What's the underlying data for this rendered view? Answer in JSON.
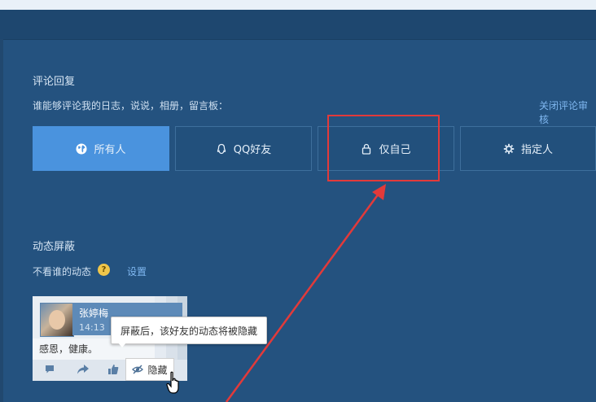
{
  "comment_reply": {
    "title": "评论回复",
    "question": "谁能够评论我的日志，说说，相册，留言板：",
    "close_review_link": "关闭评论审核",
    "options": [
      {
        "label": "所有人",
        "icon": "globe-icon",
        "selected": true
      },
      {
        "label": "QQ好友",
        "icon": "qq-penguin-icon",
        "selected": false
      },
      {
        "label": "仅自己",
        "icon": "lock-icon",
        "selected": false
      },
      {
        "label": "指定人",
        "icon": "gear-icon",
        "selected": false
      }
    ]
  },
  "feed_block": {
    "title": "动态屏蔽",
    "label": "不看谁的动态",
    "help_glyph": "?",
    "settings_link": "设置"
  },
  "demo_card": {
    "user_name": "张婷梅",
    "time": "14:13",
    "content": "感恩，健康。",
    "tooltip": "屏蔽后，该好友的动态将被隐藏",
    "hide_button": "隐藏"
  },
  "colors": {
    "page_bg": "#24527f",
    "selected_option": "#4a93de",
    "highlight_box": "#e23a3a",
    "link": "#7fb7f0"
  }
}
